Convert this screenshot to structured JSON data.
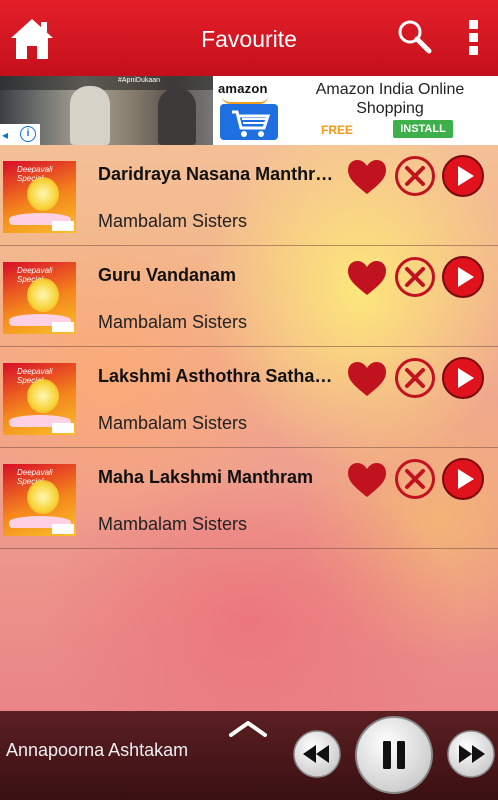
{
  "header": {
    "title": "Favourite"
  },
  "ad": {
    "hashtag": "#ApniDukaan",
    "logo_text": "amazon",
    "headline": "Amazon India Online Shopping",
    "free_label": "FREE",
    "install_label": "INSTALL"
  },
  "thumbnail_caption": "Deepavali Special",
  "songs": [
    {
      "title": "Daridraya Nasana Manthram",
      "artist": "Mambalam Sisters"
    },
    {
      "title": "Guru Vandanam",
      "artist": "Mambalam Sisters"
    },
    {
      "title": "Lakshmi Asthothra Sathanamavali",
      "artist": "Mambalam Sisters"
    },
    {
      "title": "Maha Lakshmi Manthram",
      "artist": "Mambalam Sisters"
    }
  ],
  "player": {
    "now_playing": "Annapoorna Ashtakam"
  },
  "icons": {
    "home": "home-icon",
    "search": "search-icon",
    "menu": "overflow-menu-icon",
    "favourite": "heart-icon",
    "remove": "close-circle-icon",
    "play": "play-icon",
    "expand": "chevron-up-icon",
    "rewind": "rewind-icon",
    "pause": "pause-icon",
    "forward": "fast-forward-icon"
  },
  "colors": {
    "header_red": "#d4141f",
    "heart_red": "#c1121f",
    "play_red": "#e0121c",
    "player_bg": "#4a171a"
  }
}
